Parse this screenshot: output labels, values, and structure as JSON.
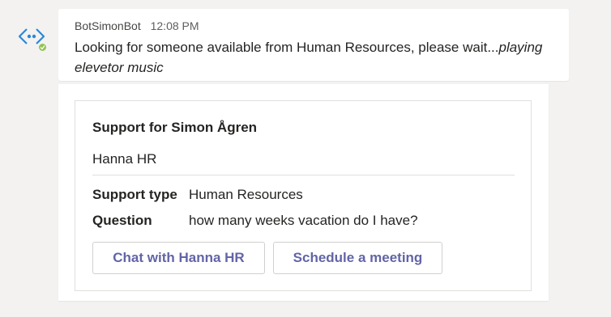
{
  "message": {
    "sender": "BotSimonBot",
    "timestamp": "12:08 PM",
    "text_plain": "Looking for someone available from Human Resources, please wait...",
    "text_italic": "playing elevetor music"
  },
  "avatar": {
    "icon": "bot-code-icon",
    "presence": "available",
    "accent_color": "#2b88d8",
    "presence_color": "#92c353"
  },
  "card": {
    "title": "Support for Simon Ågren",
    "agent_name": "Hanna HR",
    "facts": [
      {
        "key": "Support type",
        "value": "Human Resources"
      },
      {
        "key": "Question",
        "value": "how many weeks vacation do I have?"
      }
    ],
    "actions": [
      {
        "label": "Chat with Hanna HR"
      },
      {
        "label": "Schedule a meeting"
      }
    ],
    "action_color": "#6264a7"
  }
}
